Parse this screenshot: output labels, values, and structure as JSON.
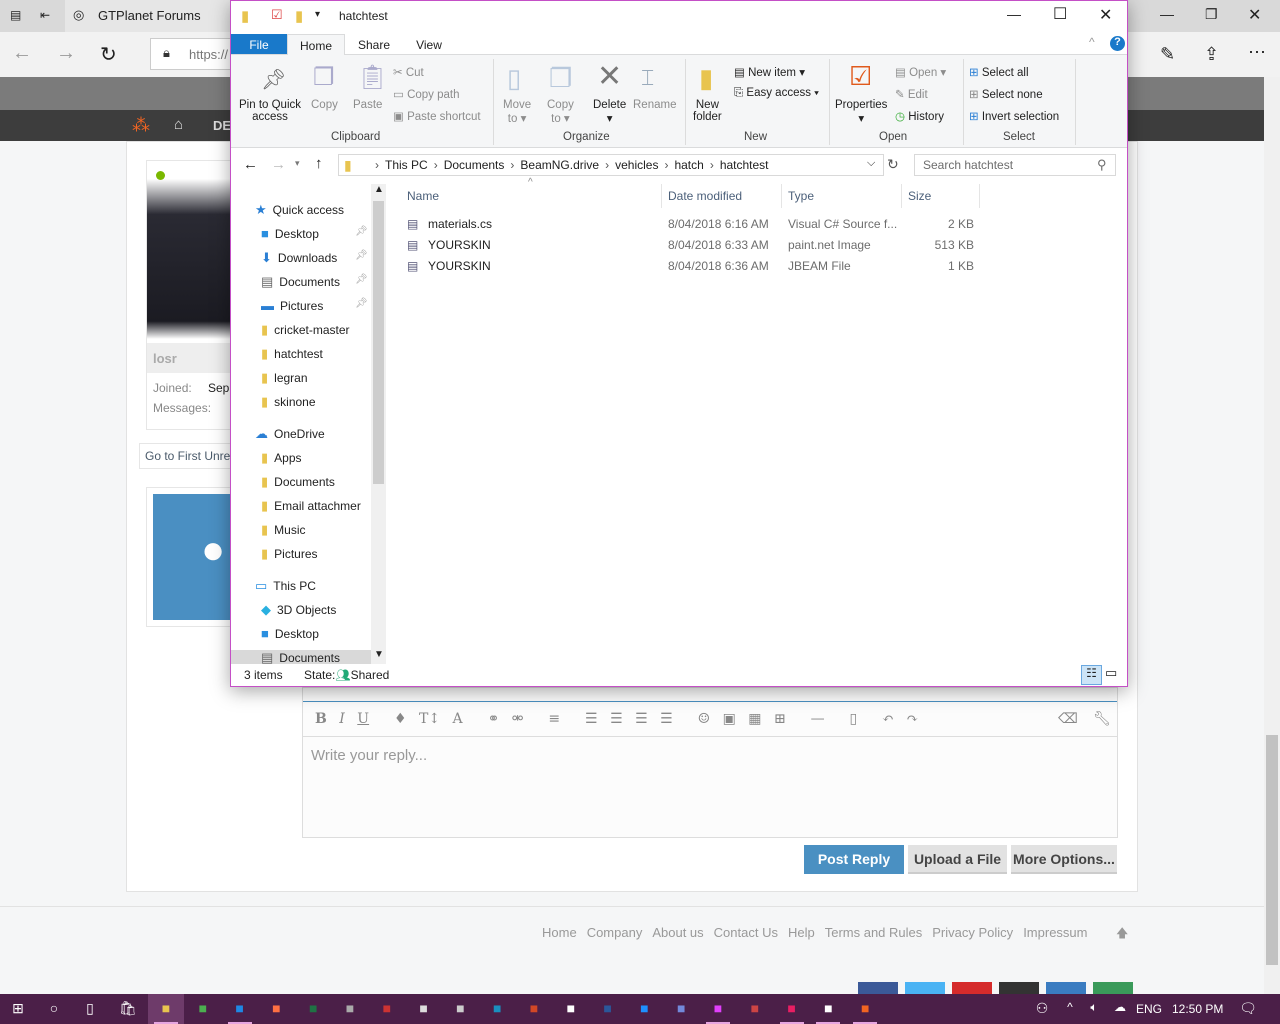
{
  "browser": {
    "tab_title": "GTPlanet Forums",
    "url": "https://",
    "site_nav_label": "DE"
  },
  "forum": {
    "username": "losr",
    "joined_label": "Joined:",
    "joined_value": "Sep",
    "messages_label": "Messages:",
    "first_unread": "Go to First Unre"
  },
  "explorer": {
    "title": "hatchtest",
    "tabs": [
      "File",
      "Home",
      "Share",
      "View"
    ],
    "ribbon": {
      "pin": "Pin to Quick",
      "pin2": "access",
      "copy": "Copy",
      "paste": "Paste",
      "cut": "Cut",
      "copy_path": "Copy path",
      "paste_shortcut": "Paste shortcut",
      "clipboard": "Clipboard",
      "move": "Move",
      "move2": "to",
      "copyto": "Copy",
      "copyto2": "to",
      "delete": "Delete",
      "rename": "Rename",
      "organize": "Organize",
      "new_folder": "New",
      "new_folder2": "folder",
      "new_item": "New item",
      "easy_access": "Easy access",
      "new": "New",
      "properties": "Properties",
      "open": "Open",
      "edit": "Edit",
      "history": "History",
      "open_group": "Open",
      "select_all": "Select all",
      "select_none": "Select none",
      "invert": "Invert selection",
      "select": "Select"
    },
    "breadcrumb": [
      "This PC",
      "Documents",
      "BeamNG.drive",
      "vehicles",
      "hatch",
      "hatchtest"
    ],
    "search_placeholder": "Search hatchtest",
    "columns": [
      "Name",
      "Date modified",
      "Type",
      "Size"
    ],
    "files": [
      {
        "name": "materials.cs",
        "date": "8/04/2018 6:16 AM",
        "type": "Visual C# Source f...",
        "size": "2 KB",
        "icon": "cs-file-icon"
      },
      {
        "name": "YOURSKIN",
        "date": "8/04/2018 6:33 AM",
        "type": "paint.net Image",
        "size": "513 KB",
        "icon": "paintnet-file-icon"
      },
      {
        "name": "YOURSKIN",
        "date": "8/04/2018 6:36 AM",
        "type": "JBEAM File",
        "size": "1 KB",
        "icon": "jbeam-file-icon"
      }
    ],
    "nav": [
      {
        "label": "Quick access",
        "icon": "star",
        "lvl": 0,
        "pin": false
      },
      {
        "label": "Desktop",
        "icon": "desktop",
        "lvl": 1,
        "pin": true
      },
      {
        "label": "Downloads",
        "icon": "download",
        "lvl": 1,
        "pin": true
      },
      {
        "label": "Documents",
        "icon": "doc",
        "lvl": 1,
        "pin": true
      },
      {
        "label": "Pictures",
        "icon": "pic",
        "lvl": 1,
        "pin": true
      },
      {
        "label": "cricket-master",
        "icon": "folder",
        "lvl": 1,
        "pin": false
      },
      {
        "label": "hatchtest",
        "icon": "folder",
        "lvl": 1,
        "pin": false
      },
      {
        "label": "legran",
        "icon": "folder",
        "lvl": 1,
        "pin": false
      },
      {
        "label": "skinone",
        "icon": "folder",
        "lvl": 1,
        "pin": false
      },
      {
        "label": "OneDrive",
        "icon": "cloud",
        "lvl": 0,
        "pin": false
      },
      {
        "label": "Apps",
        "icon": "sync",
        "lvl": 1,
        "pin": false
      },
      {
        "label": "Documents",
        "icon": "sync",
        "lvl": 1,
        "pin": false
      },
      {
        "label": "Email attachmer",
        "icon": "sync",
        "lvl": 1,
        "pin": false
      },
      {
        "label": "Music",
        "icon": "sync",
        "lvl": 1,
        "pin": false
      },
      {
        "label": "Pictures",
        "icon": "sync",
        "lvl": 1,
        "pin": false
      },
      {
        "label": "This PC",
        "icon": "pc",
        "lvl": 0,
        "pin": false
      },
      {
        "label": "3D Objects",
        "icon": "cube",
        "lvl": 1,
        "pin": false
      },
      {
        "label": "Desktop",
        "icon": "desktop",
        "lvl": 1,
        "pin": false
      },
      {
        "label": "Documents",
        "icon": "doc",
        "lvl": 1,
        "pin": false
      }
    ],
    "status_items": "3 items",
    "status_state": "State:",
    "status_shared": "Shared"
  },
  "editor": {
    "placeholder": "Write your reply...",
    "post": "Post Reply",
    "upload": "Upload a File",
    "more": "More Options..."
  },
  "footer": [
    "Home",
    "Company",
    "About us",
    "Contact Us",
    "Help",
    "Terms and Rules",
    "Privacy Policy",
    "Impressum"
  ],
  "taskbar": {
    "lang": "ENG",
    "time": "12:50 PM",
    "apps": [
      "file-explorer",
      "chrome",
      "edge",
      "firefox",
      "excel",
      "app-a",
      "app-b",
      "app-c",
      "app-d",
      "app-e",
      "powerpoint",
      "steam",
      "word",
      "internet-explorer",
      "discord",
      "app-f",
      "paint-net",
      "app-g",
      "app-h",
      "beamng"
    ]
  },
  "colors": {
    "accent": "#1979ca",
    "taskbar": "#4b1f48",
    "post": "#4a90c2"
  }
}
